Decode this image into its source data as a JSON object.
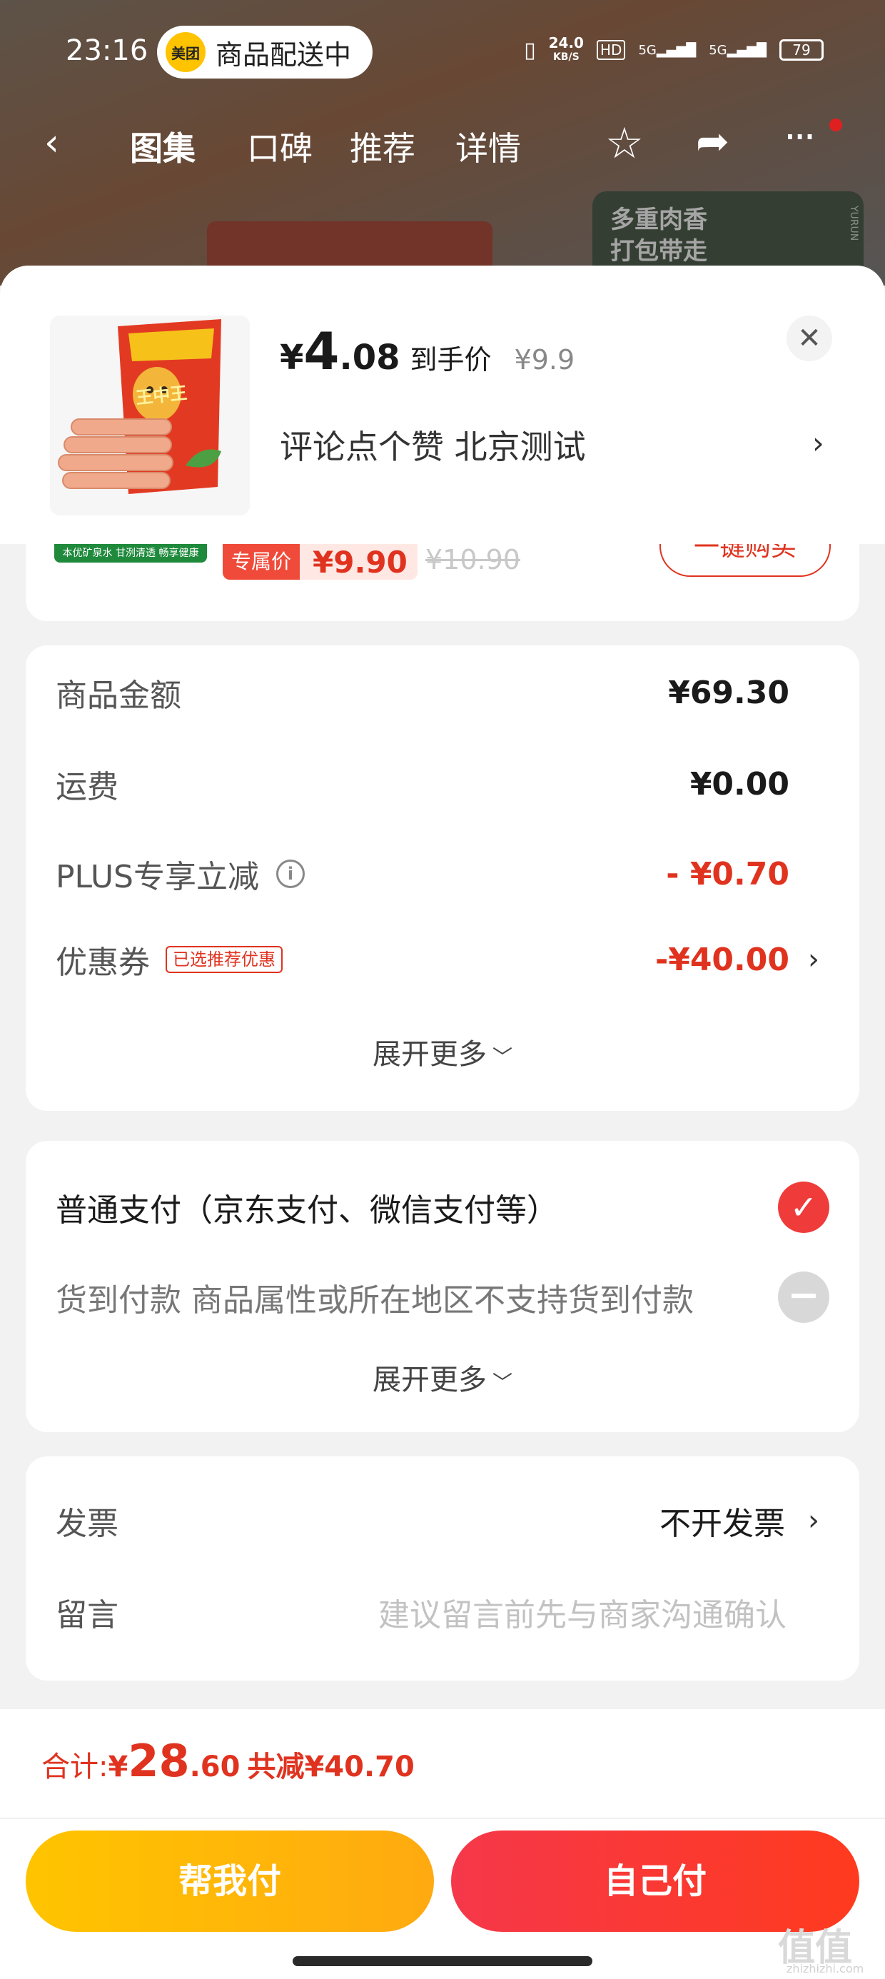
{
  "status_bar": {
    "time": "23:16",
    "app_pill_logo": "美团",
    "app_pill_text": "商品配送中",
    "net_speed_value": "24.0",
    "net_speed_unit": "KB/S",
    "hd_label": "HD",
    "signal_1": "5G",
    "signal_2": "5G",
    "battery": "79"
  },
  "nav": {
    "tabs": [
      "图集",
      "口碑",
      "推荐",
      "详情"
    ],
    "icons": [
      "back-icon",
      "star-icon",
      "share-icon",
      "more-icon"
    ]
  },
  "background": {
    "side_banner_line1": "多重肉香",
    "side_banner_line2": "打包带走",
    "side_banner_vertical": "YURUN"
  },
  "product": {
    "currency": "¥",
    "price_int": "4",
    "price_dec": ".08",
    "price_label": "到手价",
    "original_price": "¥9.9",
    "spec_text": "评论点个赞  北京测试",
    "package_text": "王中王"
  },
  "fragment": {
    "green_badge": "本优矿泉水 甘洌清透 畅享健康",
    "exclusive_tag": "专属价",
    "exclusive_price": "¥9.90",
    "strike_price": "¥10.90",
    "buy_button": "一键购买"
  },
  "summary": {
    "rows": [
      {
        "label": "商品金额",
        "value": "¥69.30"
      },
      {
        "label": "运费",
        "value": "¥0.00"
      },
      {
        "label": "PLUS专享立减",
        "value": "- ¥0.70"
      },
      {
        "label": "优惠券",
        "value": "-¥40.00",
        "tag": "已选推荐优惠"
      }
    ],
    "expand_label": "展开更多"
  },
  "payment": {
    "option_normal": "普通支付（京东支付、微信支付等）",
    "option_cod": "货到付款  商品属性或所在地区不支持货到付款",
    "expand_label": "展开更多"
  },
  "extra": {
    "invoice_label": "发票",
    "invoice_value": "不开发票",
    "message_label": "留言",
    "message_placeholder": "建议留言前先与商家沟通确认"
  },
  "bottom_bar": {
    "total_label": "合计:",
    "total_currency": "¥",
    "total_int": "28",
    "total_dec": ".60",
    "total_save": "共减¥40.70",
    "help_pay_button": "帮我付",
    "self_pay_button": "自己付"
  },
  "watermark": {
    "text": "值值值",
    "sub": "zhizhizhi.com"
  },
  "colors": {
    "accent_red": "#e0331f",
    "help_yellow": "#ffc400",
    "pay_red": "#f5384a",
    "check_red": "#f03b3b"
  }
}
